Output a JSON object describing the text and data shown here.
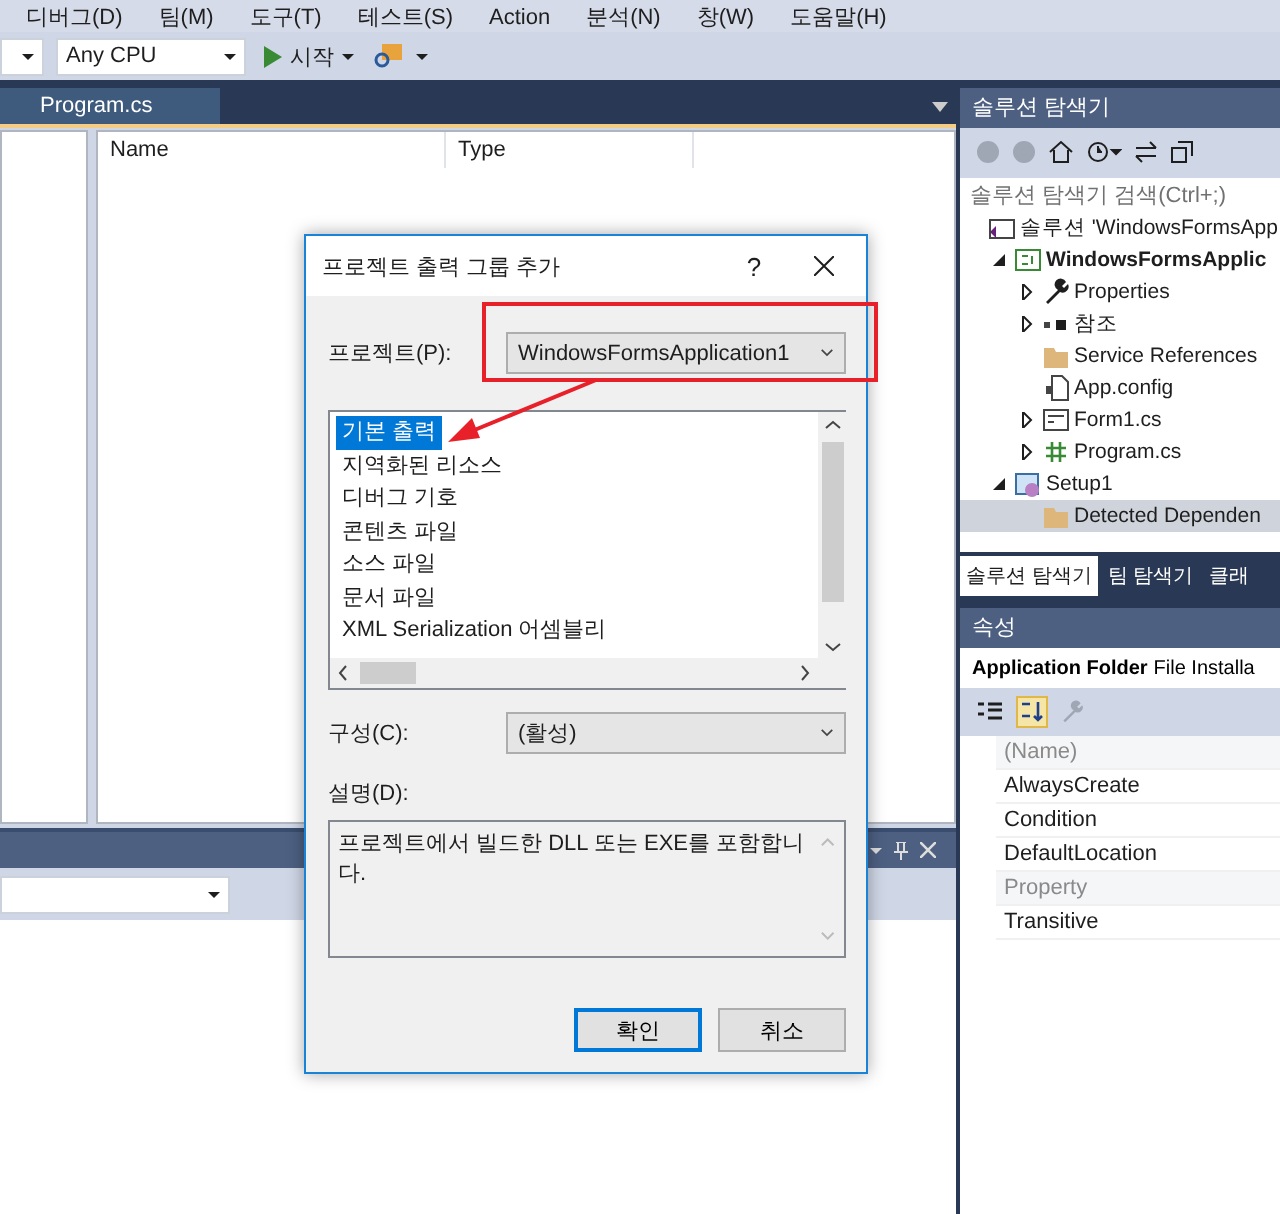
{
  "menu": [
    "디버그(D)",
    "팀(M)",
    "도구(T)",
    "테스트(S)",
    "Action",
    "분석(N)",
    "창(W)",
    "도움말(H)"
  ],
  "toolbar": {
    "platform": "Any CPU",
    "start": "시작"
  },
  "document_tab": {
    "label": "Program.cs",
    "selected": true
  },
  "table": {
    "columns": [
      "Name",
      "Type"
    ]
  },
  "solution_explorer": {
    "title": "솔루션 탐색기",
    "search": {
      "placeholder": "솔루션 탐색기 검색(Ctrl+;)"
    },
    "tree": [
      {
        "label": "솔루션 'WindowsFormsApp",
        "kind": "solution",
        "selected": false,
        "children": [
          {
            "label": "WindowsFormsApplic",
            "kind": "project",
            "expanded": true,
            "selected": false,
            "children": [
              {
                "label": "Properties",
                "kind": "properties",
                "expanded": false,
                "selected": false
              },
              {
                "label": "참조",
                "kind": "references",
                "expanded": false,
                "selected": false
              },
              {
                "label": "Service References",
                "kind": "folder",
                "selected": false
              },
              {
                "label": "App.config",
                "kind": "config",
                "selected": false
              },
              {
                "label": "Form1.cs",
                "kind": "form",
                "expanded": false,
                "selected": false
              },
              {
                "label": "Program.cs",
                "kind": "csharp",
                "expanded": false,
                "selected": false
              }
            ]
          },
          {
            "label": "Setup1",
            "kind": "setup",
            "expanded": true,
            "selected": false,
            "children": [
              {
                "label": "Detected Dependen",
                "kind": "folder",
                "selected": true
              }
            ]
          }
        ]
      }
    ],
    "tabs": [
      {
        "label": "솔루션 탐색기",
        "selected": true
      },
      {
        "label": "팀 탐색기",
        "selected": false
      },
      {
        "label": "클래",
        "selected": false
      }
    ]
  },
  "properties": {
    "title": "속성",
    "object": "Application Folder",
    "type": "File Installa",
    "rows": [
      {
        "name": "(Name)",
        "disabled": true
      },
      {
        "name": "AlwaysCreate",
        "disabled": false
      },
      {
        "name": "Condition",
        "disabled": false
      },
      {
        "name": "DefaultLocation",
        "disabled": false
      },
      {
        "name": "Property",
        "disabled": true
      },
      {
        "name": "Transitive",
        "disabled": false
      }
    ]
  },
  "dialog": {
    "title": "프로젝트 출력 그룹 추가",
    "help": "?",
    "project": {
      "label": "프로젝트(P):",
      "value": "WindowsFormsApplication1"
    },
    "outputs": [
      {
        "label": "기본 출력",
        "selected": true
      },
      {
        "label": "지역화된 리소스",
        "selected": false
      },
      {
        "label": "디버그 기호",
        "selected": false
      },
      {
        "label": "콘텐츠 파일",
        "selected": false
      },
      {
        "label": "소스 파일",
        "selected": false
      },
      {
        "label": "문서 파일",
        "selected": false
      },
      {
        "label": "XML Serialization 어셈블리",
        "selected": false
      }
    ],
    "config": {
      "label": "구성(C):",
      "value": "(활성)"
    },
    "description": {
      "label": "설명(D):",
      "value": "프로젝트에서 빌드한 DLL 또는 EXE를 포함합니다."
    },
    "buttons": [
      {
        "label": "확인",
        "default": true
      },
      {
        "label": "취소",
        "default": false
      }
    ]
  }
}
